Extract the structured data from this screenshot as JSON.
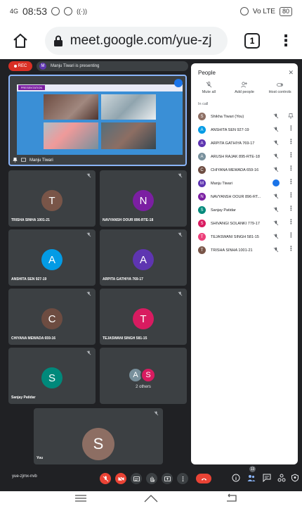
{
  "status_bar": {
    "time": "08:53",
    "signal": "4G",
    "network": "Vo LTE",
    "battery": "80"
  },
  "browser": {
    "url": "meet.google.com/yue-zj",
    "tab_count": "1"
  },
  "meeting": {
    "rec_label": "REC",
    "presenting_text": "Manju Tiwari is presenting",
    "presenter_initial": "M",
    "presenter_name": "Manju Tiwari",
    "slide_badge": "PRESENTATION",
    "code": "yue-zjmx-nvb",
    "chat_count": "13"
  },
  "tiles": [
    {
      "initial": "T",
      "name": "TRISHA SINHA 1001-21",
      "color": "#795548"
    },
    {
      "initial": "N",
      "name": "NAVYANSH OOUR 896-RTE-18",
      "color": "#7b1fa2"
    },
    {
      "initial": "A",
      "name": "ANSHITA SEN 927-19",
      "color": "#039be5"
    },
    {
      "initial": "A",
      "name": "ARPITA GATHIYA 769-17",
      "color": "#5e35b1"
    },
    {
      "initial": "C",
      "name": "CHIYANA MEWADA 659-16",
      "color": "#6d4c41"
    },
    {
      "initial": "T",
      "name": "TEJASWANI SINGH 581-15",
      "color": "#d81b60"
    },
    {
      "initial": "S",
      "name": "Sanjay Patidar",
      "color": "#00897b"
    }
  ],
  "others_tile": {
    "label": "2 others",
    "a_initial": "A",
    "a_color": "#78909c",
    "s_initial": "S",
    "s_color": "#d81b60"
  },
  "you_tile": {
    "initial": "S",
    "label": "You",
    "color": "#8d6e63"
  },
  "people_panel": {
    "title": "People",
    "actions": [
      "Mute all",
      "Add people",
      "Host controls"
    ],
    "section": "In call",
    "participants": [
      {
        "initial": "S",
        "name": "Shikha Tiwari (You)",
        "color": "#8d6e63"
      },
      {
        "initial": "A",
        "name": "ANSHITA SEN 927-19",
        "color": "#039be5"
      },
      {
        "initial": "A",
        "name": "ARPITA GATHIYA 769-17",
        "color": "#5e35b1"
      },
      {
        "initial": "A",
        "name": "ARUSH RAJAK 895-RTE-18",
        "color": "#78909c"
      },
      {
        "initial": "C",
        "name": "CHIYANA MEWADA 659-16",
        "color": "#6d4c41"
      },
      {
        "initial": "M",
        "name": "Manju Tiwari",
        "color": "#5e35b1"
      },
      {
        "initial": "N",
        "name": "NAVYANSH OOUR 896-RT...",
        "color": "#7b1fa2"
      },
      {
        "initial": "S",
        "name": "Sanjay Patidar",
        "color": "#00897b"
      },
      {
        "initial": "S",
        "name": "SHIVANGI SOLANKI 779-17",
        "color": "#d81b60"
      },
      {
        "initial": "T",
        "name": "TEJASWANI SINGH 581-15",
        "color": "#ec407a"
      },
      {
        "initial": "T",
        "name": "TRISHA SINHA 1001-21",
        "color": "#795548"
      }
    ]
  }
}
